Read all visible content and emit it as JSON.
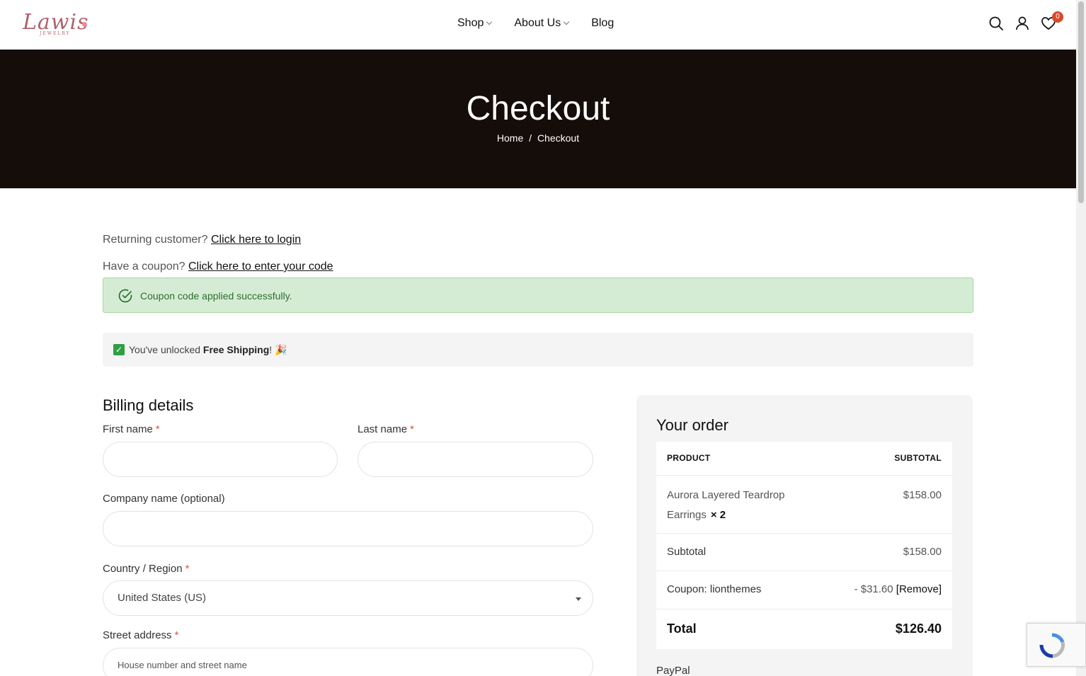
{
  "brand": {
    "name": "Lawis",
    "tagline": "JEWELRY",
    "accent": "#b0616b"
  },
  "nav": {
    "items": [
      {
        "label": "Shop",
        "has_dropdown": true
      },
      {
        "label": "About Us",
        "has_dropdown": true
      },
      {
        "label": "Blog",
        "has_dropdown": false
      }
    ]
  },
  "header_icons": {
    "search": "search-icon",
    "account": "user-icon",
    "wishlist": "heart-icon",
    "wishlist_count": "0"
  },
  "hero": {
    "title": "Checkout",
    "breadcrumb": {
      "home": "Home",
      "separator": "/",
      "current": "Checkout"
    },
    "background": "#150d09"
  },
  "notices": {
    "login_prompt": "Returning customer?",
    "login_link": "Click here to login",
    "coupon_prompt": "Have a coupon?",
    "coupon_link": "Click here to enter your code",
    "success_message": "Coupon code applied successfully.",
    "shipping_prefix": "You've unlocked",
    "shipping_bold": "Free Shipping",
    "shipping_suffix": "! 🎉"
  },
  "billing": {
    "title": "Billing details",
    "first_name_label": "First name",
    "last_name_label": "Last name",
    "company_label": "Company name (optional)",
    "country_label": "Country / Region",
    "country_value": "United States (US)",
    "street_label": "Street address",
    "street_placeholder": "House number and street name",
    "required_mark": "*"
  },
  "order": {
    "title": "Your order",
    "col_product": "PRODUCT",
    "col_subtotal": "SUBTOTAL",
    "item_name": "Aurora Layered Teardrop Earrings",
    "item_qty": "× 2",
    "item_price": "$158.00",
    "subtotal_label": "Subtotal",
    "subtotal_value": "$158.00",
    "coupon_label": "Coupon: lionthemes",
    "coupon_value": "- $31.60",
    "coupon_remove": "[Remove]",
    "total_label": "Total",
    "total_value": "$126.40",
    "payment_method": "PayPal"
  }
}
